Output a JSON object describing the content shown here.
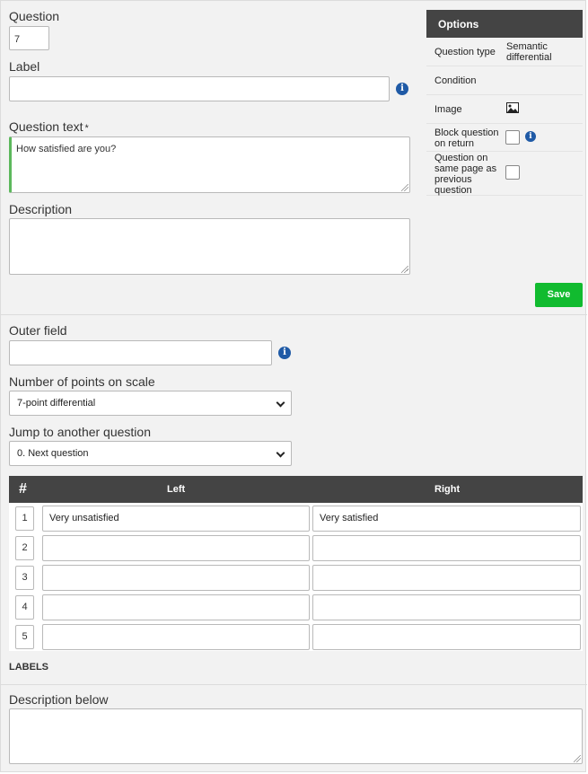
{
  "question": {
    "label": "Question",
    "number": "7"
  },
  "label_field": {
    "label": "Label",
    "value": ""
  },
  "question_text": {
    "label": "Question text",
    "required_mark": "*",
    "value": "How satisfied are you?"
  },
  "description": {
    "label": "Description",
    "value": ""
  },
  "options": {
    "header": "Options",
    "question_type_key": "Question type",
    "question_type_value_line1": "Semantic",
    "question_type_value_line2": "differential",
    "condition_key": "Condition",
    "image_key": "Image",
    "block_key_line1": "Block question",
    "block_key_line2": "on return",
    "same_page_key_line1": "Question on",
    "same_page_key_line2": "same page as",
    "same_page_key_line3": "previous",
    "same_page_key_line4": "question"
  },
  "save_label": "Save",
  "outer_field": {
    "label": "Outer field",
    "value": ""
  },
  "scale_points": {
    "label": "Number of points on scale",
    "selected": "7-point differential"
  },
  "jump": {
    "label": "Jump to another question",
    "selected": "0. Next question"
  },
  "table": {
    "col_hash": "#",
    "col_left": "Left",
    "col_right": "Right",
    "rows": [
      {
        "n": "1",
        "left": "Very unsatisfied",
        "right": "Very satisfied"
      },
      {
        "n": "2",
        "left": "",
        "right": ""
      },
      {
        "n": "3",
        "left": "",
        "right": ""
      },
      {
        "n": "4",
        "left": "",
        "right": ""
      },
      {
        "n": "5",
        "left": "",
        "right": ""
      }
    ]
  },
  "labels_heading": "LABELS",
  "description_below": {
    "label": "Description below",
    "value": ""
  },
  "colors": {
    "accent_green": "#5cb85c",
    "save_green": "#11bb2f",
    "header_dark": "#444444",
    "info_blue": "#1f5aa6"
  }
}
